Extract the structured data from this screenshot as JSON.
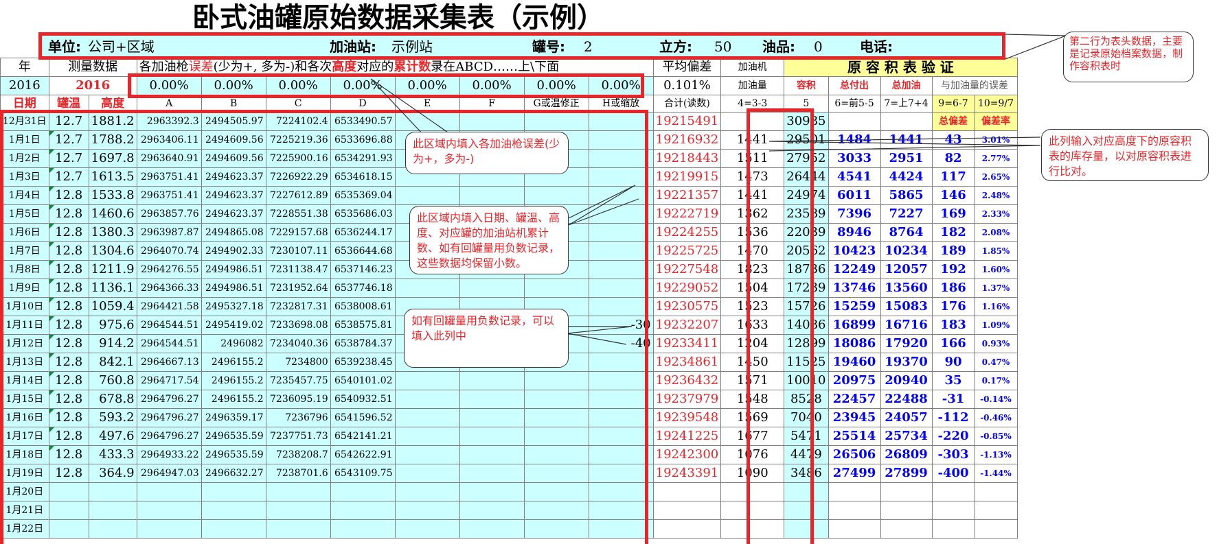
{
  "title": "卧式油罐原始数据采集表（示例）",
  "header": {
    "unit_label": "单位:",
    "unit_value": "公司+区域",
    "station_label": "加油站:",
    "station_value": "示例站",
    "tank_label": "罐号:",
    "tank_value": "2",
    "volume_label": "立方:",
    "volume_value": "50",
    "oil_label": "油品:",
    "oil_value": "0",
    "phone_label": "电话:",
    "phone_value": ""
  },
  "row1": {
    "year": "年",
    "measure": "测量数据",
    "desc_a": "各加油枪",
    "desc_b": "误差",
    "desc_c": "(少为+, 多为-)和各次",
    "desc_d": "高度",
    "desc_e": "对应的",
    "desc_f": "累计数",
    "desc_g": "录在ABCD……上\\下面",
    "avg_dev": "平均偏差",
    "pump_vol_1": "加油机",
    "verify": "原 容 积 表 验 证"
  },
  "row2": {
    "year": "2016",
    "year_red": "2016",
    "errors": [
      "0.00%",
      "0.00%",
      "0.00%",
      "0.00%",
      "0.00%",
      "0.00%",
      "0.00%",
      "0.00%"
    ],
    "avg_val": "0.101%",
    "pump_vol_2": "加油量",
    "vol": "容积",
    "total_out": "总付出",
    "total_add": "总加油",
    "err_label": "与加油量的误差"
  },
  "row3": {
    "date": "日期",
    "temp": "罐温",
    "height": "高度",
    "cols": [
      "A",
      "B",
      "C",
      "D",
      "E",
      "F",
      "G或温修正",
      "H或缩放"
    ],
    "total_read": "合计(读数)",
    "f4": "4=3-3",
    "f5": "5",
    "f6": "6=前5-5",
    "f7": "7=上7+4",
    "f9": "9=6-7",
    "f10": "10=9/7"
  },
  "rows": [
    {
      "date": "12月31日",
      "temp": "12.7",
      "height": "1881.2",
      "a": "2963392.3",
      "b": "2494505.97",
      "c": "7224102.4",
      "d": "6533490.57",
      "h": "",
      "total": "19215491",
      "pump": "",
      "vol": "30985",
      "out": "",
      "add": "",
      "dev": "总偏差",
      "rate": "偏差率"
    },
    {
      "date": "1月1日",
      "temp": "12.7",
      "height": "1788.2",
      "a": "2963406.11",
      "b": "2494609.56",
      "c": "7225219.36",
      "d": "6533696.88",
      "h": "",
      "total": "19216932",
      "pump": "1441",
      "vol": "29501",
      "out": "1484",
      "add": "1441",
      "dev": "43",
      "rate": "3.01%"
    },
    {
      "date": "1月2日",
      "temp": "12.7",
      "height": "1697.8",
      "a": "2963640.91",
      "b": "2494609.56",
      "c": "7225900.16",
      "d": "6534291.93",
      "h": "",
      "total": "19218443",
      "pump": "1511",
      "vol": "27952",
      "out": "3033",
      "add": "2951",
      "dev": "82",
      "rate": "2.77%"
    },
    {
      "date": "1月3日",
      "temp": "12.7",
      "height": "1613.5",
      "a": "2963751.41",
      "b": "2494623.37",
      "c": "7226922.29",
      "d": "6534618.15",
      "h": "",
      "total": "19219915",
      "pump": "1473",
      "vol": "26444",
      "out": "4541",
      "add": "4424",
      "dev": "117",
      "rate": "2.65%"
    },
    {
      "date": "1月4日",
      "temp": "12.8",
      "height": "1533.8",
      "a": "2963751.41",
      "b": "2494623.37",
      "c": "7227612.89",
      "d": "6535369.04",
      "h": "",
      "total": "19221357",
      "pump": "1441",
      "vol": "24974",
      "out": "6011",
      "add": "5865",
      "dev": "146",
      "rate": "2.48%"
    },
    {
      "date": "1月5日",
      "temp": "12.8",
      "height": "1460.6",
      "a": "2963857.76",
      "b": "2494623.37",
      "c": "7228551.38",
      "d": "6535686.03",
      "h": "",
      "total": "19222719",
      "pump": "1362",
      "vol": "23589",
      "out": "7396",
      "add": "7227",
      "dev": "169",
      "rate": "2.33%"
    },
    {
      "date": "1月6日",
      "temp": "12.8",
      "height": "1380.3",
      "a": "2963987.87",
      "b": "2494865.08",
      "c": "7229157.68",
      "d": "6536244.17",
      "h": "",
      "total": "19224255",
      "pump": "1536",
      "vol": "22039",
      "out": "8946",
      "add": "8764",
      "dev": "182",
      "rate": "2.08%"
    },
    {
      "date": "1月7日",
      "temp": "12.8",
      "height": "1304.6",
      "a": "2964070.74",
      "b": "2494902.33",
      "c": "7230107.11",
      "d": "6536644.68",
      "h": "",
      "total": "19225725",
      "pump": "1470",
      "vol": "20562",
      "out": "10423",
      "add": "10234",
      "dev": "189",
      "rate": "1.85%"
    },
    {
      "date": "1月8日",
      "temp": "12.8",
      "height": "1211.9",
      "a": "2964276.55",
      "b": "2494986.51",
      "c": "7231138.47",
      "d": "6537146.23",
      "h": "",
      "total": "19227548",
      "pump": "1823",
      "vol": "18736",
      "out": "12249",
      "add": "12057",
      "dev": "192",
      "rate": "1.60%"
    },
    {
      "date": "1月9日",
      "temp": "12.8",
      "height": "1136.1",
      "a": "2964366.33",
      "b": "2494986.51",
      "c": "7231952.64",
      "d": "6537746.18",
      "h": "",
      "total": "19229052",
      "pump": "1504",
      "vol": "17239",
      "out": "13746",
      "add": "13560",
      "dev": "186",
      "rate": "1.37%"
    },
    {
      "date": "1月10日",
      "temp": "12.8",
      "height": "1059.4",
      "a": "2964421.58",
      "b": "2495327.18",
      "c": "7232817.31",
      "d": "6538008.61",
      "h": "",
      "total": "19230575",
      "pump": "1523",
      "vol": "15726",
      "out": "15259",
      "add": "15083",
      "dev": "176",
      "rate": "1.16%"
    },
    {
      "date": "1月11日",
      "temp": "12.8",
      "height": "975.6",
      "a": "2964544.51",
      "b": "2495419.02",
      "c": "7233698.08",
      "d": "6538575.81",
      "h": "-30",
      "total": "19232207",
      "pump": "1633",
      "vol": "14086",
      "out": "16899",
      "add": "16716",
      "dev": "183",
      "rate": "1.09%"
    },
    {
      "date": "1月12日",
      "temp": "12.8",
      "height": "914.2",
      "a": "2964544.51",
      "b": "2496082",
      "c": "7234040.36",
      "d": "6538784.37",
      "h": "-40",
      "total": "19233411",
      "pump": "1204",
      "vol": "12899",
      "out": "18086",
      "add": "17920",
      "dev": "166",
      "rate": "0.93%"
    },
    {
      "date": "1月13日",
      "temp": "12.8",
      "height": "842.1",
      "a": "2964667.13",
      "b": "2496155.2",
      "c": "7234800",
      "d": "6539238.45",
      "h": "",
      "total": "19234861",
      "pump": "1450",
      "vol": "11525",
      "out": "19460",
      "add": "19370",
      "dev": "90",
      "rate": "0.47%"
    },
    {
      "date": "1月14日",
      "temp": "12.8",
      "height": "760.8",
      "a": "2964717.54",
      "b": "2496155.2",
      "c": "7235457.75",
      "d": "6540101.02",
      "h": "",
      "total": "19236432",
      "pump": "1571",
      "vol": "10010",
      "out": "20975",
      "add": "20940",
      "dev": "35",
      "rate": "0.17%"
    },
    {
      "date": "1月15日",
      "temp": "12.8",
      "height": "678.8",
      "a": "2964796.27",
      "b": "2496155.2",
      "c": "7236095.19",
      "d": "6540932.51",
      "h": "",
      "total": "19237979",
      "pump": "1548",
      "vol": "8528",
      "out": "22457",
      "add": "22488",
      "dev": "-31",
      "rate": "-0.14%"
    },
    {
      "date": "1月16日",
      "temp": "12.8",
      "height": "593.2",
      "a": "2964796.27",
      "b": "2496359.17",
      "c": "7236796",
      "d": "6541596.52",
      "h": "",
      "total": "19239548",
      "pump": "1569",
      "vol": "7040",
      "out": "23945",
      "add": "24057",
      "dev": "-112",
      "rate": "-0.46%"
    },
    {
      "date": "1月17日",
      "temp": "12.8",
      "height": "497.6",
      "a": "2964796.27",
      "b": "2496535.59",
      "c": "7237751.73",
      "d": "6542141.21",
      "h": "",
      "total": "19241225",
      "pump": "1677",
      "vol": "5471",
      "out": "25514",
      "add": "25734",
      "dev": "-220",
      "rate": "-0.85%"
    },
    {
      "date": "1月18日",
      "temp": "12.8",
      "height": "433.3",
      "a": "2964933.22",
      "b": "2496535.59",
      "c": "7238208.7",
      "d": "6542622.91",
      "h": "",
      "total": "19242300",
      "pump": "1076",
      "vol": "4479",
      "out": "26506",
      "add": "26809",
      "dev": "-303",
      "rate": "-1.13%"
    },
    {
      "date": "1月19日",
      "temp": "12.8",
      "height": "364.9",
      "a": "2964947.03",
      "b": "2496632.27",
      "c": "7238701.6",
      "d": "6543109.75",
      "h": "",
      "total": "19243391",
      "pump": "1090",
      "vol": "3486",
      "out": "27499",
      "add": "27899",
      "dev": "-400",
      "rate": "-1.44%"
    },
    {
      "date": "1月20日",
      "temp": "",
      "height": "",
      "a": "",
      "b": "",
      "c": "",
      "d": "",
      "h": "",
      "total": "",
      "pump": "",
      "vol": "",
      "out": "",
      "add": "",
      "dev": "",
      "rate": ""
    },
    {
      "date": "1月21日",
      "temp": "",
      "height": "",
      "a": "",
      "b": "",
      "c": "",
      "d": "",
      "h": "",
      "total": "",
      "pump": "",
      "vol": "",
      "out": "",
      "add": "",
      "dev": "",
      "rate": ""
    },
    {
      "date": "1月22日",
      "temp": "",
      "height": "",
      "a": "",
      "b": "",
      "c": "",
      "d": "",
      "h": "",
      "total": "",
      "pump": "",
      "vol": "",
      "out": "",
      "add": "",
      "dev": "",
      "rate": ""
    }
  ],
  "callouts": {
    "header_note": "第二行为表头数据，主要是记录原始档案数据，制作容积表时",
    "error_note": "此区域内填入各加油枪误差(少为+，多为-)",
    "data_note": "此区域内填入日期、罐温、高度、对应罐的加油站机累计数、如有回罐量用负数记录，这些数据均保留小数。",
    "return_note": "如有回罐量用负数记录，可以填入此列中",
    "volume_note": "此列输入对应高度下的原容积表的库存量，以对原容积表进行比对。"
  },
  "colors": {
    "red": "#e8262a",
    "blue": "#0000ff",
    "cyan": "#ccffff",
    "yellow": "#ffff99"
  }
}
